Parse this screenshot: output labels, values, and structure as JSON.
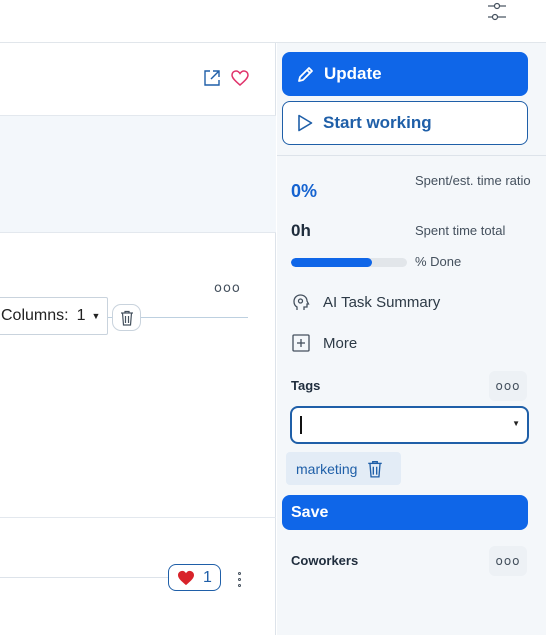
{
  "topbar": {
    "filter_icon": "sliders-icon"
  },
  "main": {
    "icons": {
      "open_external": "external-link-icon",
      "favorite": "heart-outline-icon"
    },
    "more_label": "ooo",
    "columns": {
      "label": "Columns:",
      "value": "1"
    },
    "like": {
      "icon": "heart-icon",
      "count": "1"
    }
  },
  "sidebar": {
    "update_label": "Update",
    "start_label": "Start working",
    "ratio_value": "0%",
    "ratio_label": "Spent/est. time ratio",
    "spent_value": "0h",
    "spent_label": "Spent time total",
    "done_label": "% Done",
    "done_fraction": 0.7,
    "ai_summary_label": "AI Task Summary",
    "more_label": "More",
    "tags_title": "Tags",
    "tags_input_value": "",
    "tags": [
      "marketing"
    ],
    "save_label": "Save",
    "coworkers_title": "Coworkers",
    "dots_label": "ooo"
  },
  "colors": {
    "primary": "#0f66e8",
    "outline": "#1f5fa8",
    "heart": "#e0336b"
  }
}
